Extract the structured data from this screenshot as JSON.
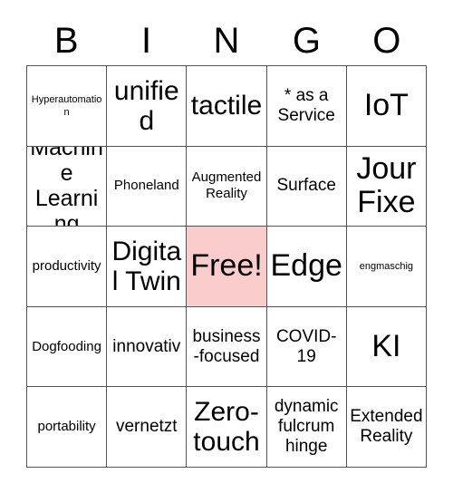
{
  "card": {
    "title_letters": [
      "B",
      "I",
      "N",
      "G",
      "O"
    ],
    "free_cell_color": "#fbcccc",
    "grid_line_color": "#555555",
    "background_color": "#ffffff",
    "columns": 5,
    "rows": 5,
    "cells": [
      {
        "text": "Hyperautomation",
        "size": "fs-xs",
        "free": false
      },
      {
        "text": "unified",
        "size": "fs-xl",
        "free": false
      },
      {
        "text": "tactile",
        "size": "fs-xl",
        "free": false
      },
      {
        "text": "* as a Service",
        "size": "fs-md",
        "free": false
      },
      {
        "text": "IoT",
        "size": "fs-xxl",
        "free": false
      },
      {
        "text": "Machine Learning",
        "size": "fs-lg",
        "free": false
      },
      {
        "text": "Phoneland",
        "size": "fs-sm",
        "free": false
      },
      {
        "text": "Augmented Reality",
        "size": "fs-sm",
        "free": false
      },
      {
        "text": "Surface",
        "size": "fs-md",
        "free": false
      },
      {
        "text": "Jour Fixe",
        "size": "fs-xxl",
        "free": false
      },
      {
        "text": "productivity",
        "size": "fs-sm",
        "free": false
      },
      {
        "text": "Digital Twin",
        "size": "fs-xl",
        "free": false
      },
      {
        "text": "Free!",
        "size": "fs-xxl",
        "free": true
      },
      {
        "text": "Edge",
        "size": "fs-xxl",
        "free": false
      },
      {
        "text": "engmaschig",
        "size": "fs-xs",
        "free": false
      },
      {
        "text": "Dogfooding",
        "size": "fs-sm",
        "free": false
      },
      {
        "text": "innovativ",
        "size": "fs-md",
        "free": false
      },
      {
        "text": "business-focused",
        "size": "fs-md",
        "free": false
      },
      {
        "text": "COVID-19",
        "size": "fs-md",
        "free": false
      },
      {
        "text": "KI",
        "size": "fs-xxl",
        "free": false
      },
      {
        "text": "portability",
        "size": "fs-sm",
        "free": false
      },
      {
        "text": "vernetzt",
        "size": "fs-md",
        "free": false
      },
      {
        "text": "Zero-touch",
        "size": "fs-xl",
        "free": false
      },
      {
        "text": "dynamic fulcrum hinge",
        "size": "fs-md",
        "free": false
      },
      {
        "text": "Extended Reality",
        "size": "fs-md",
        "free": false
      }
    ]
  }
}
